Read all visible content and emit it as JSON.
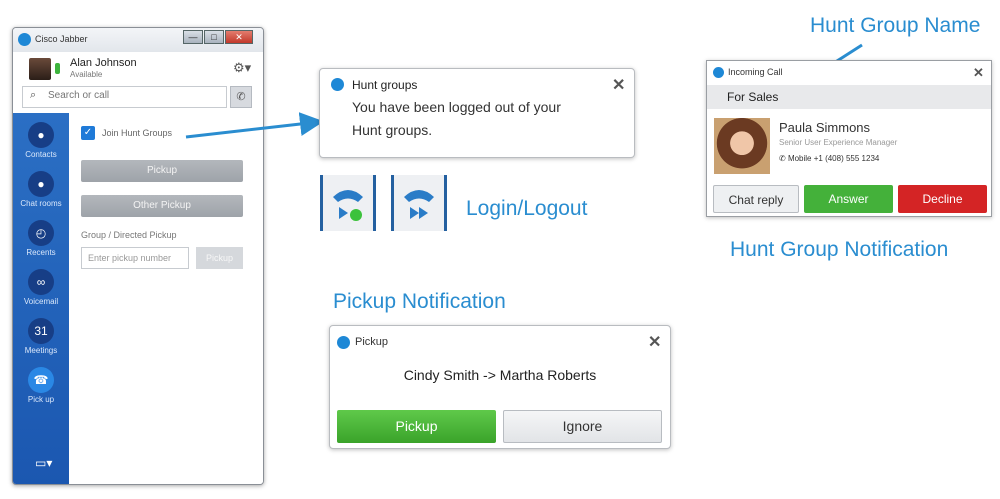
{
  "jabber": {
    "title": "Cisco Jabber",
    "window_controls": {
      "minimize": "—",
      "maximize": "□",
      "close": "✕"
    },
    "user": {
      "name": "Alan Johnson",
      "status": "Available"
    },
    "search_placeholder": "Search or call",
    "rail": [
      {
        "label": "Contacts",
        "icon": "person-icon",
        "glyph": "●"
      },
      {
        "label": "Chat rooms",
        "icon": "chat-rooms-icon",
        "glyph": "●"
      },
      {
        "label": "Recents",
        "icon": "clock-icon",
        "glyph": "◴"
      },
      {
        "label": "Voicemail",
        "icon": "voicemail-icon",
        "glyph": "∞"
      },
      {
        "label": "Meetings",
        "icon": "calendar-icon",
        "glyph": "31"
      },
      {
        "label": "Pick up",
        "icon": "pickup-icon",
        "glyph": "☎"
      }
    ],
    "join_hunt_groups_label": "Join Hunt Groups",
    "pickup_button": "Pickup",
    "other_pickup_button": "Other Pickup",
    "group_directed_label": "Group / Directed Pickup",
    "pickup_number_placeholder": "Enter pickup number",
    "pickup_small_button": "Pickup"
  },
  "hunt_popup": {
    "title": "Hunt groups",
    "message_line1": "You have been logged out of your",
    "message_line2": "Hunt groups."
  },
  "login_logout_label": "Login/Logout",
  "incoming_call": {
    "title": "Incoming Call",
    "group": "For Sales",
    "caller_name": "Paula Simmons",
    "caller_title": "Senior User Experience Manager",
    "caller_phone": "Mobile +1 (408) 555 1234",
    "chat_reply": "Chat reply",
    "answer": "Answer",
    "decline": "Decline",
    "answer_color": "#44b13a",
    "decline_color": "#d42425"
  },
  "labels": {
    "hunt_group_name": "Hunt Group Name",
    "hunt_group_notification": "Hunt Group Notification",
    "pickup_notification": "Pickup Notification"
  },
  "pickup_popup": {
    "title": "Pickup",
    "message": "Cindy Smith -> Martha Roberts",
    "pickup_button": "Pickup",
    "ignore_button": "Ignore"
  },
  "colors": {
    "accent": "#2a8dd0",
    "jabber_rail": "#1f5fb8",
    "pickup_green": "#49b436"
  }
}
